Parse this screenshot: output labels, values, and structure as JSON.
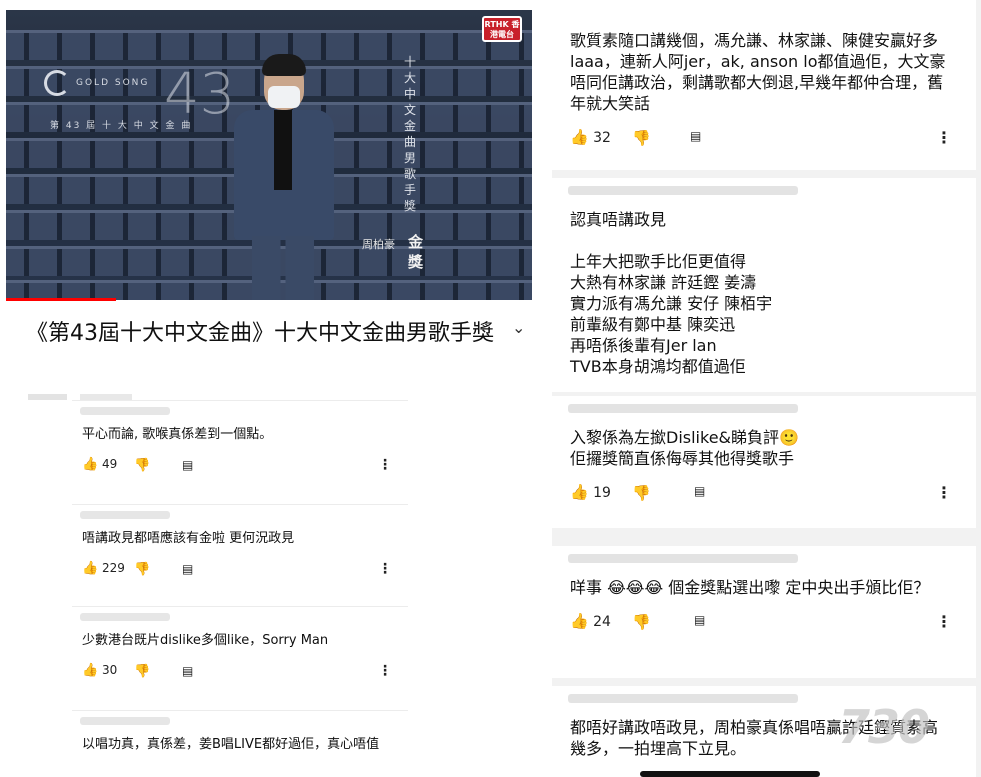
{
  "video": {
    "logo_word": "GOLD SONG",
    "logo_number": "43",
    "logo_sub": "第 43 屆 十 大 中 文 金 曲",
    "broadcaster": "RTHK 香港電台",
    "vertical_title": "十大中文金曲男歌手獎",
    "award": "金獎",
    "winner": "周柏豪"
  },
  "title": "《第43屆十大中文金曲》十大中文金曲男歌手獎",
  "left_comments": [
    {
      "text": "平心而論, 歌喉真係差到一個點。",
      "likes": "49"
    },
    {
      "text": "唔講政見都唔應該有金啦 更何況政見",
      "likes": "229"
    },
    {
      "text": "少數港台既片dislike多個like，Sorry Man",
      "likes": "30"
    },
    {
      "text": "以唱功真，真係差，姜B唱LIVE都好過佢，真心唔值",
      "likes": ""
    }
  ],
  "right_comments": [
    {
      "lines": [
        "歌質素隨口講幾個，馮允謙、林家謙、陳健安贏好多laaa，連新人阿jer，ak, anson lo都值過佢，大文豪唔同佢講政治，剩講歌都大倒退,早幾年都仲合理，舊年就大笑話"
      ],
      "likes": "32"
    },
    {
      "lines": [
        "認真唔講政見",
        "",
        "上年大把歌手比佢更值得",
        "大熱有林家謙 許廷鏗 姜濤",
        "實力派有馮允謙 安仔 陳栢宇",
        "前輩級有鄭中基 陳奕迅",
        "再唔係後輩有Jer lan",
        "TVB本身胡鴻均都值過佢"
      ],
      "likes": ""
    },
    {
      "lines": [
        "入黎係為左撳Dislike&睇負評🙂",
        "佢攞獎簡直係侮辱其他得獎歌手"
      ],
      "likes": "19"
    },
    {
      "lines": [
        "咩事 😂😂😂 個金獎點選出嚟 定中央出手頒比佢？"
      ],
      "likes": "24"
    },
    {
      "lines": [
        "都唔好講政唔政見，周柏豪真係唱唔贏許廷鏗質素高幾多，一拍埋高下立見。"
      ],
      "likes": ""
    }
  ],
  "icons": {
    "like": "thumbs-up-icon",
    "dislike": "thumbs-down-icon",
    "reply": "reply-icon",
    "more": "more-vert-icon",
    "expand": "chevron-down-icon"
  },
  "glyphs": {
    "like": "👍",
    "dislike": "👎",
    "reply": "▤",
    "more": "⋮",
    "expand": "⌄"
  },
  "watermark": "730",
  "colors": {
    "progress": "#ff0000",
    "rthk": "#c8202a"
  }
}
